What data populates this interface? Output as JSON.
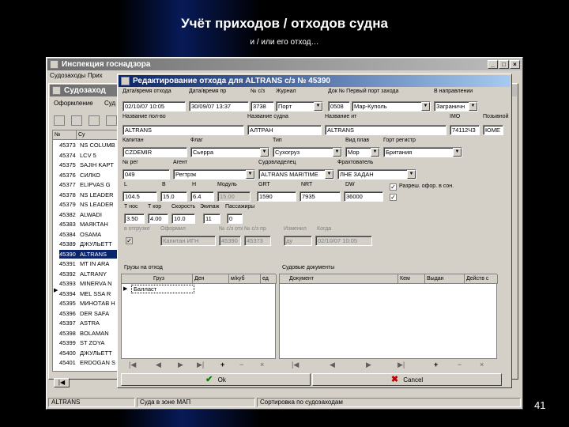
{
  "slide": {
    "title": "Учёт приходов / отходов судна",
    "subtitle": "и / или его отход…",
    "page_number": "41"
  },
  "main_window": {
    "title": "Инспекция госнадзора",
    "menu": [
      "Судозаходы",
      "Прих"
    ],
    "child_title": "Судозаход",
    "child_menu": [
      "Оформление",
      "Суд"
    ],
    "list_header": [
      "№",
      "Су"
    ],
    "rows": [
      {
        "id": "45373",
        "name": "NS COLUMB"
      },
      {
        "id": "45374",
        "name": "LCV 5"
      },
      {
        "id": "45375",
        "name": "SAJIH KAPT"
      },
      {
        "id": "45376",
        "name": "СИЛКО"
      },
      {
        "id": "45377",
        "name": "ELIPVAS G"
      },
      {
        "id": "45378",
        "name": "NS LEADER"
      },
      {
        "id": "45379",
        "name": "NS LEADER"
      },
      {
        "id": "45382",
        "name": "ALWADI"
      },
      {
        "id": "45383",
        "name": "МАЯКТАН"
      },
      {
        "id": "45384",
        "name": "OSAMA"
      },
      {
        "id": "45389",
        "name": "ДЖУЛЬЕТТ"
      },
      {
        "id": "45390",
        "name": "ALTRANS"
      },
      {
        "id": "45391",
        "name": "MT IN ARA"
      },
      {
        "id": "45392",
        "name": "ALTRANY"
      },
      {
        "id": "45393",
        "name": "MINERVA N"
      },
      {
        "id": "45394",
        "name": "MEL SSA R"
      },
      {
        "id": "45395",
        "name": "МИНОТАВ Н"
      },
      {
        "id": "45396",
        "name": "DER SAFA"
      },
      {
        "id": "45397",
        "name": "ASTRA"
      },
      {
        "id": "45398",
        "name": "BOLAMAN"
      },
      {
        "id": "45399",
        "name": "ST ZOYA"
      },
      {
        "id": "45400",
        "name": "ДЖУЛЬЕТТ"
      },
      {
        "id": "45401",
        "name": "ERDOGAN S"
      }
    ],
    "selected_row": 11,
    "status": [
      "ALTRANS",
      "Суда в зоне МАП",
      "Сортировка по судозаходам"
    ]
  },
  "dialog": {
    "title": "Редактирование отхода для ALTRANS с/з № 45390",
    "labels": {
      "date_departure": "Дата/время отхода",
      "date_arrival": "Дата/время пр",
      "ship_no": "№ с/з",
      "journal": "Журнал",
      "port_doc": "Док № Первый порт захода",
      "in_direction": "В направлении",
      "name_rus": "Название пол-во",
      "name_ship": "Название судна",
      "name_other": "Название ит",
      "imo": "IMO",
      "call_sign": "Позывной",
      "captain": "Капитан",
      "flag": "Флаг",
      "type": "Тип",
      "nav_type": "Вид плав",
      "register": "Горт регистр",
      "permit_no": "№ рег",
      "agent": "Агент",
      "owner": "Судовладелец",
      "charterer": "Фрахтователь",
      "dim_l": "L",
      "dim_b": "B",
      "dim_h": "H",
      "module": "Модуль",
      "grt": "GRT",
      "nrt": "NRT",
      "dw": "DW",
      "permit_check": "Разреш. офор. в сон.",
      "draft_fore": "Т нос",
      "draft_aft": "Т кор",
      "speed": "Скорость",
      "crew": "Экипаж",
      "passengers": "Пассажиры",
      "ok_label": "в отгрузке",
      "formed_by": "Оформил",
      "no_ot": "№ с/з отх",
      "no_ch": "№ с/з пр",
      "changed": "Изменил",
      "when": "Когда"
    },
    "values": {
      "date_departure": "02/10/07 10:05",
      "date_arrival": "30/09/07 13:37",
      "ship_no": "3738",
      "journal": "Порт",
      "doc_no": "0508",
      "first_port": "Мар-Куполь",
      "in_direction": "Заграничн",
      "name_rus": "ALTRANS",
      "name_ship": "АЛТРАН",
      "name_other": "ALTRANS",
      "imo": "74112ЧЗ",
      "call_sign": "ЮМЕ",
      "captain": "CZDEMIR",
      "flag": "Сьерра",
      "type": "Сухогруз",
      "nav_type": "Мор",
      "register": "Британия",
      "permit_no": "049",
      "agent": "Регтрэк",
      "owner": "ALTRANS MARITIME",
      "charterer": "ЛНЕ ЗАДАН",
      "dim_l": "104.5",
      "dim_b": "15.0",
      "dim_h": "6.4",
      "module": "15.00",
      "grt": "1590",
      "nrt": "7935",
      "dw": "36000",
      "draft_fore": "3.50",
      "draft_aft": "4.00",
      "speed": "10.0",
      "crew": "11",
      "passengers": "0",
      "formed_by": "Капитан ИГН",
      "no_ot": "45390",
      "no_ch": "45373",
      "changed": "ду",
      "when": "02/10/07 10:05"
    },
    "cargo": {
      "title": "Грузы на отход",
      "columns": [
        "Груз",
        "Ден",
        "м/куб",
        "ед"
      ],
      "rows": [
        [
          "Балласт"
        ]
      ]
    },
    "docs": {
      "title": "Судовые документы",
      "columns": [
        "Документ",
        "Кем",
        "Выдан",
        "Действ с"
      ]
    },
    "buttons": {
      "ok": "Ok",
      "cancel": "Cancel"
    }
  }
}
